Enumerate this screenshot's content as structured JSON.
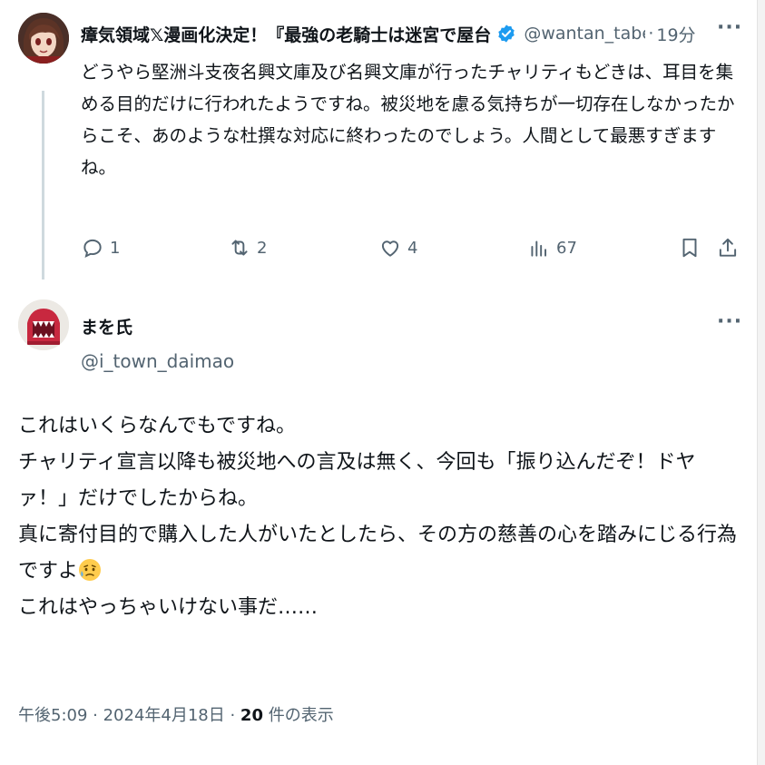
{
  "reply_tweet": {
    "name": "瘴気領域𝕏漫画化決定！『最強の老騎士は迷宮で屋台",
    "handle": "@wantan_tabe",
    "separator": "·",
    "time": "19分",
    "more": "···",
    "text_lines": [
      "どうやら堅洲斗支夜名興文庫及び名興文庫が行ったチャリティもどきは、耳目を集",
      "める目的だけに行われたようですね。被災地を慮る気持ちが一切存在しなかったか",
      "らこそ、あのような杜撰な対応に終わったのでしょう。人間として最悪すぎます",
      "ね。"
    ],
    "actions": {
      "replies": "1",
      "retweets": "2",
      "likes": "4",
      "views": "67"
    },
    "icons": [
      "reply-icon",
      "retweet-icon",
      "like-icon",
      "views-icon",
      "bookmark-icon",
      "share-icon"
    ],
    "colors": {
      "verified": "#1d9bf0",
      "muted": "#536471"
    }
  },
  "main_tweet": {
    "name": "まを氏",
    "handle": "@i_town_daimao",
    "more": "···",
    "lines": [
      "これはいくらなんでもですね。",
      "チャリティ宣言以降も被災地への言及は無く、今回も「振り込んだぞ！ドヤ",
      "ァ！」だけでしたからね。",
      "真に寄付目的で購入した人がいたとしたら、その方の慈善の心を踏みにじる行為",
      "ですよ",
      "これはやっちゃいけない事だ……"
    ],
    "emoji": "sad-but-relieved-face",
    "timestamp": "午後5:09 · 2024年4月18日 · ",
    "view_count": "20",
    "view_label": " 件の表示"
  }
}
